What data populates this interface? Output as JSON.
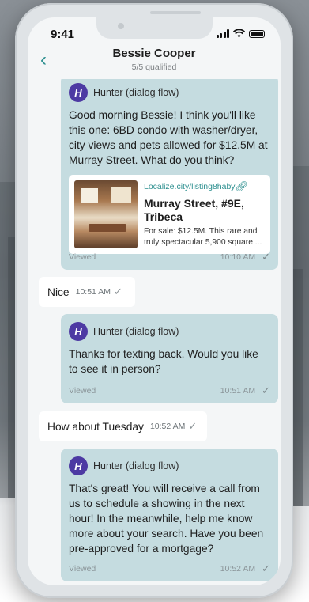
{
  "status_bar": {
    "time": "9:41"
  },
  "header": {
    "title": "Bessie Cooper",
    "subtitle": "5/5 qualified"
  },
  "messages": [
    {
      "sender": "Hunter (dialog flow)",
      "avatar_letter": "H",
      "text": "Good morning Bessie! I think you'll like this one: 6BD condo with washer/dryer, city views and pets allowed for $12.5M at Murray Street. What do you think?",
      "card": {
        "url": "Localize.city/listing8haby",
        "title": "Murray Street, #9E, Tribeca",
        "description": "For sale: $12.5M. This rare and truly spectacular 5,900 square ..."
      },
      "status": "Viewed",
      "time": "10:10 AM"
    },
    {
      "text": "Nice",
      "time": "10:51 AM"
    },
    {
      "sender": "Hunter (dialog flow)",
      "avatar_letter": "H",
      "text": "Thanks for texting back. Would you like to see it in person?",
      "status": "Viewed",
      "time": "10:51 AM"
    },
    {
      "text": "How about Tuesday",
      "time": "10:52 AM"
    },
    {
      "sender": "Hunter (dialog flow)",
      "avatar_letter": "H",
      "text": "That's great! You will receive a call from us to schedule a showing in the next hour! In the meanwhile, help me know more about your search. Have you been pre-approved for a mortgage?",
      "status": "Viewed",
      "time": "10:52 AM"
    }
  ],
  "colors": {
    "accent": "#2c8f8f",
    "bot_bubble": "#c5dce0",
    "avatar": "#4d3aa3"
  }
}
